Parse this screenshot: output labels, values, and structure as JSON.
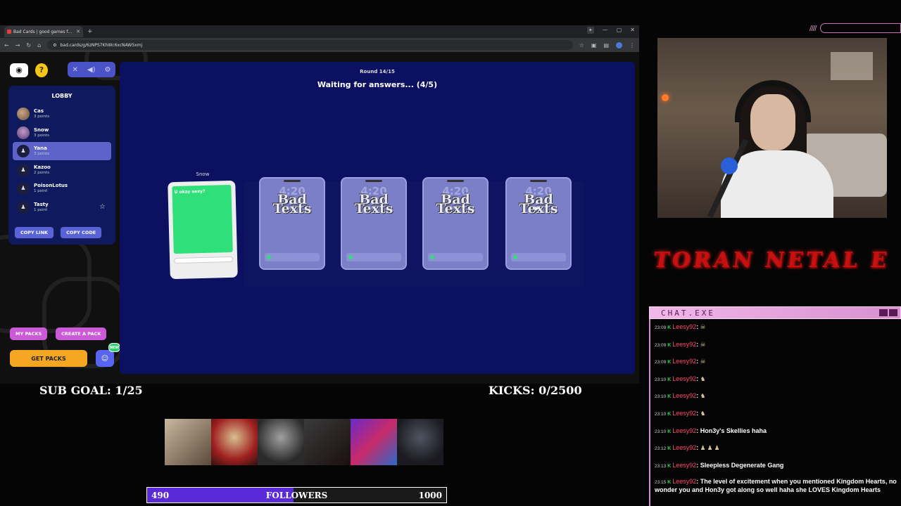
{
  "browser": {
    "tab_title": "Bad Cards | good games for yo...",
    "url": "bad.cards/g/6zNPS7KhWc6xcNAW5xmj"
  },
  "game": {
    "lobby_title": "LOBBY",
    "players": [
      {
        "name": "Cas",
        "points": "3 points",
        "avatar": "photo1",
        "active": false
      },
      {
        "name": "Snow",
        "points": "3 points",
        "avatar": "photo2",
        "active": false
      },
      {
        "name": "Yana",
        "points": "3 points",
        "avatar": "generic",
        "active": true
      },
      {
        "name": "Kazoo",
        "points": "2 points",
        "avatar": "generic",
        "active": false
      },
      {
        "name": "PoisonLotus",
        "points": "1 point",
        "avatar": "generic",
        "active": false
      },
      {
        "name": "Tasty",
        "points": "1 point",
        "avatar": "generic",
        "active": false
      }
    ],
    "copy_link": "COPY LINK",
    "copy_code": "COPY CODE",
    "my_packs": "MY PACKS",
    "create_pack": "CREATE A PACK",
    "get_packs": "GET PACKS",
    "discord_badge": "NEW",
    "round": "Round 14/15",
    "status": "Waiting for answers... (4/5)",
    "answer_author": "Snow",
    "answer_text": "U okay sexy?",
    "hidden_card_time": "4:20",
    "hidden_card_brand_line1": "Bad",
    "hidden_card_brand_line2": "Texts"
  },
  "overlay": {
    "sub_goal": "SUB GOAL: 1/25",
    "kicks": "KICKS: 0/2500",
    "followers_current": "490",
    "followers_label": "FOLLOWERS",
    "followers_max": "1000",
    "followers_progress": 0.49,
    "name_banner": "TORAN NETAL E",
    "chat_title": "CHAT.EXE"
  },
  "chat": [
    {
      "time": "23:09",
      "user": "Leesy92",
      "text": "",
      "emote": "☠"
    },
    {
      "time": "23:09",
      "user": "Leesy92",
      "text": "",
      "emote": "☠"
    },
    {
      "time": "23:09",
      "user": "Leesy92",
      "text": "",
      "emote": "☠"
    },
    {
      "time": "23:10",
      "user": "Leesy92",
      "text": "",
      "emote": "♞"
    },
    {
      "time": "23:10",
      "user": "Leesy92",
      "text": "",
      "emote": "♞"
    },
    {
      "time": "23:10",
      "user": "Leesy92",
      "text": "",
      "emote": "♞"
    },
    {
      "time": "23:10",
      "user": "Leesy92",
      "text": "Hon3y's Skellies haha",
      "emote": ""
    },
    {
      "time": "23:12",
      "user": "Leesy92",
      "text": "",
      "emote": "♟ ♟ ♟"
    },
    {
      "time": "23:13",
      "user": "Leesy92",
      "text": "Sleepless Degenerate Gang",
      "emote": ""
    },
    {
      "time": "23:15",
      "user": "Leesy92",
      "text": "The level of excitement when you mentioned Kingdom Hearts, no wonder you and Hon3y got along so well haha she LOVES Kingdom Hearts",
      "emote": ""
    }
  ]
}
